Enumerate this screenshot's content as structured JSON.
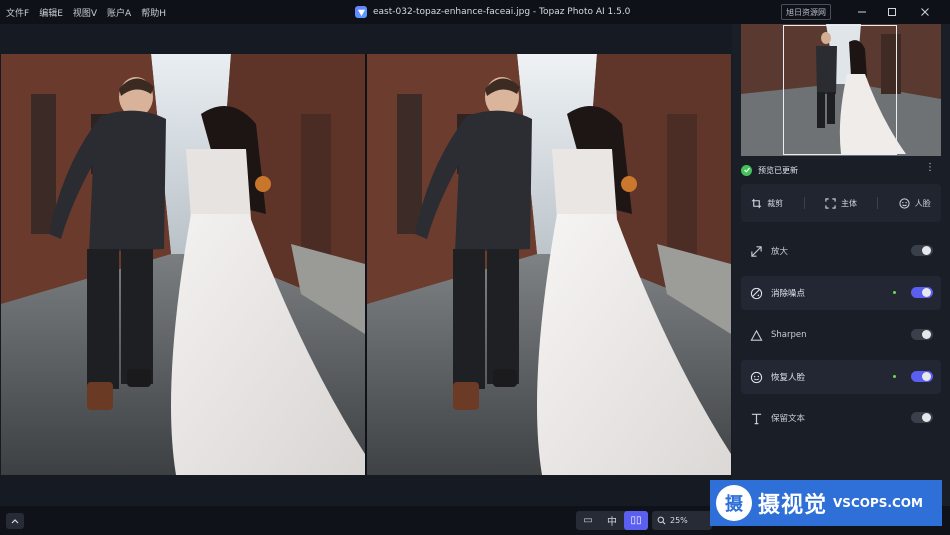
{
  "menu": [
    "文件F",
    "编辑E",
    "视图V",
    "账户A",
    "帮助H"
  ],
  "window": {
    "title": "east-032-topaz-enhance-faceai.jpg - Topaz Photo AI 1.5.0",
    "badge": "旭日资源网"
  },
  "panel": {
    "preview_status": "预览已更新",
    "tools": [
      {
        "label": "裁剪",
        "icon": "crop-icon"
      },
      {
        "label": "主体",
        "icon": "subject-icon"
      },
      {
        "label": "人脸",
        "icon": "face-icon"
      }
    ],
    "features": [
      {
        "label": "放大",
        "icon": "upscale-icon",
        "enabled": false,
        "active": false
      },
      {
        "label": "消除噪点",
        "icon": "denoise-icon",
        "enabled": true,
        "active": true
      },
      {
        "label": "Sharpen",
        "icon": "sharpen-icon",
        "enabled": false,
        "active": false
      },
      {
        "label": "恢复人脸",
        "icon": "face-recovery-icon",
        "enabled": true,
        "active": true
      },
      {
        "label": "保留文本",
        "icon": "text-icon",
        "enabled": false,
        "active": false
      }
    ]
  },
  "bottom": {
    "view_modes": [
      "▭",
      "中",
      "▯▯"
    ],
    "active_view": 2,
    "zoom": "25%"
  },
  "watermark": {
    "mark": "摄",
    "cn": "摄视觉",
    "en": "VSCOPS.COM"
  },
  "colors": {
    "accent": "#5b5ff0",
    "status_ok": "#43c35a",
    "banner": "#2e6fd8"
  }
}
